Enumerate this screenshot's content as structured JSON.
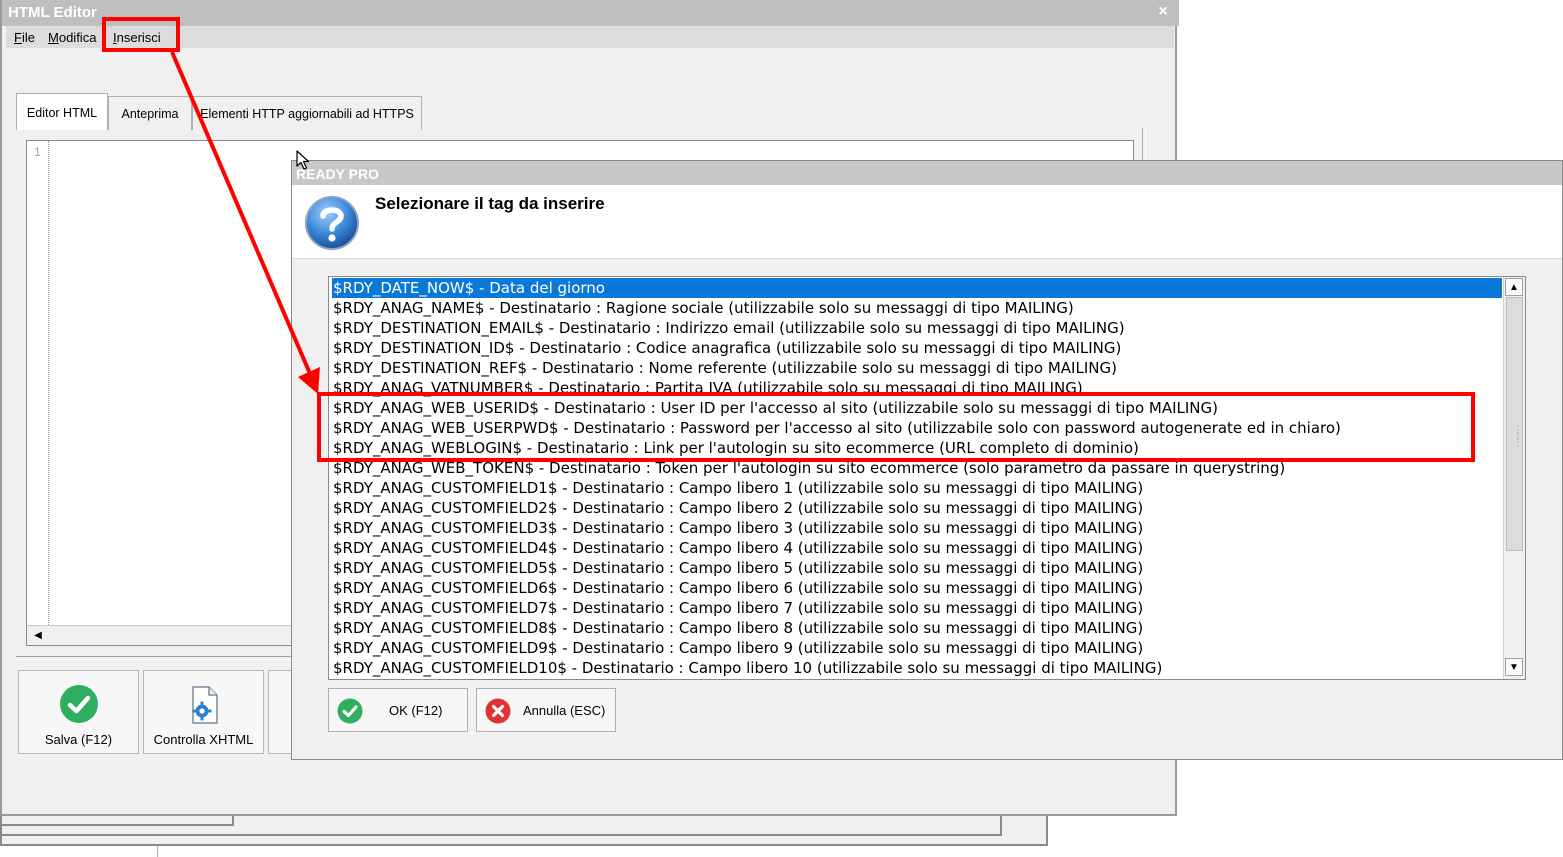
{
  "editor": {
    "title": "HTML Editor",
    "close_glyph": "×",
    "menu": [
      {
        "accel": "F",
        "rest": "ile"
      },
      {
        "accel": "M",
        "rest": "odifica"
      },
      {
        "accel": "I",
        "rest": "nserisci"
      }
    ],
    "tabs": [
      "Editor HTML",
      "Anteprima",
      "Elementi HTTP aggiornabili ad HTTPS"
    ],
    "line_number": "1",
    "buttons": [
      {
        "label": "Salva (F12)",
        "icon": "check-icon"
      },
      {
        "label": "Controlla XHTML",
        "icon": "document-gear-icon"
      }
    ]
  },
  "dialog": {
    "title": "READY PRO",
    "prompt": "Selezionare il tag da inserire",
    "icon": "question-icon",
    "tags": [
      "$RDY_DATE_NOW$ - Data del giorno",
      "$RDY_ANAG_NAME$ - Destinatario : Ragione sociale (utilizzabile solo su messaggi di tipo MAILING)",
      "$RDY_DESTINATION_EMAIL$ - Destinatario : Indirizzo email (utilizzabile solo su messaggi di tipo MAILING)",
      "$RDY_DESTINATION_ID$ - Destinatario : Codice anagrafica (utilizzabile solo su messaggi di tipo MAILING)",
      "$RDY_DESTINATION_REF$ - Destinatario : Nome referente (utilizzabile solo su messaggi di tipo MAILING)",
      "$RDY_ANAG_VATNUMBER$ - Destinatario : Partita IVA (utilizzabile solo su messaggi di tipo MAILING)",
      "$RDY_ANAG_WEB_USERID$ - Destinatario : User ID per l'accesso al sito (utilizzabile solo su messaggi di tipo MAILING)",
      "$RDY_ANAG_WEB_USERPWD$ - Destinatario : Password per l'accesso al sito (utilizzabile solo con password autogenerate ed in chiaro)",
      "$RDY_ANAG_WEBLOGIN$ - Destinatario : Link per l'autologin su sito ecommerce (URL completo di dominio)",
      "$RDY_ANAG_WEB_TOKEN$ - Destinatario : Token per l'autologin su sito ecommerce (solo parametro da passare in querystring)",
      "$RDY_ANAG_CUSTOMFIELD1$ - Destinatario : Campo libero 1 (utilizzabile solo su messaggi di tipo MAILING)",
      "$RDY_ANAG_CUSTOMFIELD2$ - Destinatario : Campo libero 2 (utilizzabile solo su messaggi di tipo MAILING)",
      "$RDY_ANAG_CUSTOMFIELD3$ - Destinatario : Campo libero 3 (utilizzabile solo su messaggi di tipo MAILING)",
      "$RDY_ANAG_CUSTOMFIELD4$ - Destinatario : Campo libero 4 (utilizzabile solo su messaggi di tipo MAILING)",
      "$RDY_ANAG_CUSTOMFIELD5$ - Destinatario : Campo libero 5 (utilizzabile solo su messaggi di tipo MAILING)",
      "$RDY_ANAG_CUSTOMFIELD6$ - Destinatario : Campo libero 6 (utilizzabile solo su messaggi di tipo MAILING)",
      "$RDY_ANAG_CUSTOMFIELD7$ - Destinatario : Campo libero 7 (utilizzabile solo su messaggi di tipo MAILING)",
      "$RDY_ANAG_CUSTOMFIELD8$ - Destinatario : Campo libero 8 (utilizzabile solo su messaggi di tipo MAILING)",
      "$RDY_ANAG_CUSTOMFIELD9$ - Destinatario : Campo libero 9 (utilizzabile solo su messaggi di tipo MAILING)",
      "$RDY_ANAG_CUSTOMFIELD10$ - Destinatario : Campo libero 10 (utilizzabile solo su messaggi di tipo MAILING)"
    ],
    "selected_index": 0,
    "ok_label": "OK (F12)",
    "cancel_label": "Annulla (ESC)"
  },
  "colors": {
    "selection": "#0a78d7",
    "annotation": "#ff0000",
    "ok_green": "#28a745",
    "cancel_red": "#e03232"
  }
}
